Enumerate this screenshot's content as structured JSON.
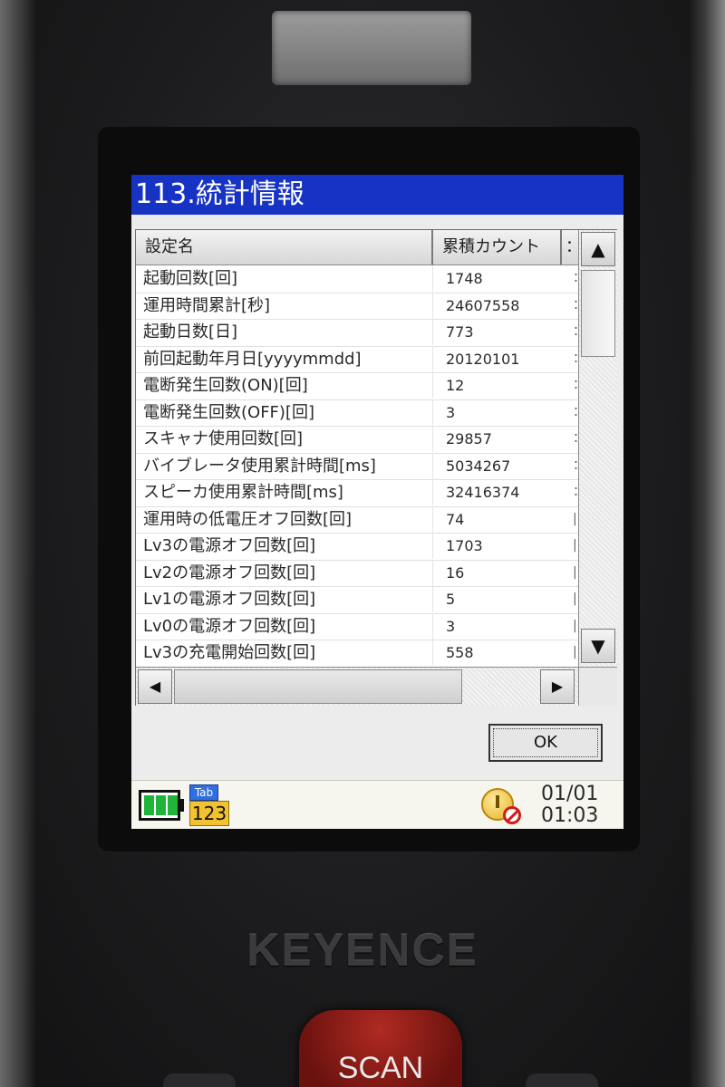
{
  "window": {
    "title": "113.統計情報"
  },
  "table": {
    "columns": [
      "設定名",
      "累積カウント",
      "："
    ],
    "rows": [
      {
        "name": "起動回数[回]",
        "count": "1748",
        "extra": "："
      },
      {
        "name": "運用時間累計[秒]",
        "count": "24607558",
        "extra": "："
      },
      {
        "name": "起動日数[日]",
        "count": "773",
        "extra": "："
      },
      {
        "name": "前回起動年月日[yyyymmdd]",
        "count": "20120101",
        "extra": "："
      },
      {
        "name": "電断発生回数(ON)[回]",
        "count": "12",
        "extra": "："
      },
      {
        "name": "電断発生回数(OFF)[回]",
        "count": "3",
        "extra": "："
      },
      {
        "name": "スキャナ使用回数[回]",
        "count": "29857",
        "extra": "："
      },
      {
        "name": "バイブレータ使用累計時間[ms]",
        "count": "5034267",
        "extra": "："
      },
      {
        "name": "スピーカ使用累計時間[ms]",
        "count": "32416374",
        "extra": "："
      },
      {
        "name": "運用時の低電圧オフ回数[回]",
        "count": "74",
        "extra": "|"
      },
      {
        "name": "Lv3の電源オフ回数[回]",
        "count": "1703",
        "extra": "|"
      },
      {
        "name": "Lv2の電源オフ回数[回]",
        "count": "16",
        "extra": "|"
      },
      {
        "name": "Lv1の電源オフ回数[回]",
        "count": "5",
        "extra": "|"
      },
      {
        "name": "Lv0の電源オフ回数[回]",
        "count": "3",
        "extra": "|"
      },
      {
        "name": "Lv3の充電開始回数[回]",
        "count": "558",
        "extra": "|"
      }
    ]
  },
  "scroll": {
    "up_icon": "▲",
    "down_icon": "▼",
    "left_icon": "◀",
    "right_icon": "▶"
  },
  "dialog": {
    "ok_label": "OK"
  },
  "taskbar": {
    "tab_badge": "Tab",
    "input_mode": "123",
    "date": "01/01",
    "time": "01:03",
    "battery_level": 1.0
  },
  "device": {
    "brand": "KEYENCE",
    "scan_label": "SCAN"
  },
  "colors": {
    "titlebar": "#1633c4",
    "battery": "#21b43a",
    "badge_blue": "#2f6fe0",
    "badge_yellow": "#f2c230"
  }
}
